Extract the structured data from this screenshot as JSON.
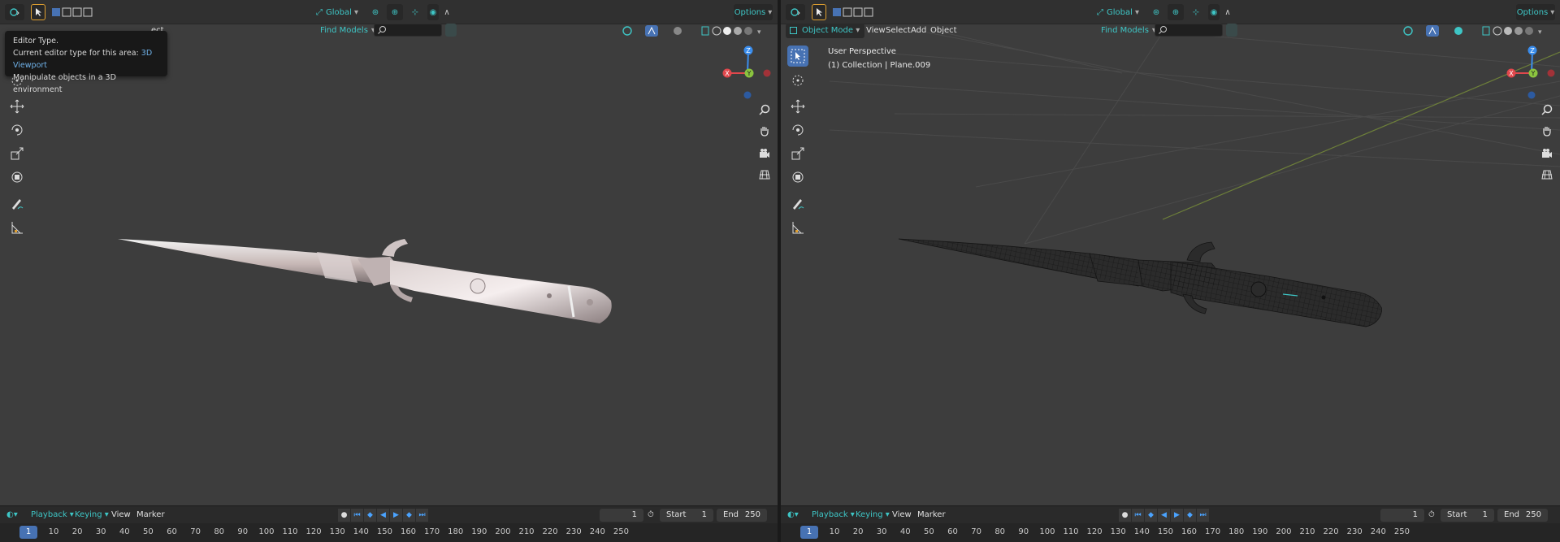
{
  "colors": {
    "accent_teal": "#3ec6c6",
    "active_blue": "#4772b3",
    "viewport_bg": "#3d3d3d",
    "axis_x": "#e0474c",
    "axis_y": "#8bc43f",
    "axis_z": "#3a8ded"
  },
  "left_viewport": {
    "header": {
      "transform_orientation": "Global",
      "options_label": "Options",
      "find_models_label": "Find Models",
      "select_fragment": "ect"
    },
    "tooltip": {
      "title": "Editor Type.",
      "line1_prefix": "Current editor type for this area:",
      "line1_value": "3D Viewport",
      "line2": "Manipulate objects in a 3D environment"
    },
    "timeline": {
      "playback": "Playback",
      "keying": "Keying",
      "view": "View",
      "marker": "Marker",
      "current_frame": "1",
      "start_label": "Start",
      "start_value": "1",
      "end_label": "End",
      "end_value": "250"
    },
    "ruler": {
      "current_frame": "1",
      "ticks": [
        "10",
        "20",
        "30",
        "40",
        "50",
        "60",
        "70",
        "80",
        "90",
        "100",
        "110",
        "120",
        "130",
        "140",
        "150",
        "160",
        "170",
        "180",
        "190",
        "200",
        "210",
        "220",
        "230",
        "240",
        "250"
      ]
    }
  },
  "right_viewport": {
    "header": {
      "transform_orientation": "Global",
      "options_label": "Options",
      "mode_label": "Object Mode",
      "menu_view": "View",
      "menu_select": "Select",
      "menu_add": "Add",
      "menu_object": "Object",
      "find_models_label": "Find Models"
    },
    "view_info": {
      "perspective": "User Perspective",
      "collection": "(1) Collection | Plane.009"
    },
    "timeline": {
      "playback": "Playback",
      "keying": "Keying",
      "view": "View",
      "marker": "Marker",
      "current_frame": "1",
      "start_label": "Start",
      "start_value": "1",
      "end_label": "End",
      "end_value": "250"
    },
    "ruler": {
      "current_frame": "1",
      "ticks": [
        "10",
        "20",
        "30",
        "40",
        "50",
        "60",
        "70",
        "80",
        "90",
        "100",
        "110",
        "120",
        "130",
        "140",
        "150",
        "160",
        "170",
        "180",
        "190",
        "200",
        "210",
        "220",
        "230",
        "240",
        "250"
      ]
    }
  },
  "icons": {
    "editor_type": "editor-type-icon",
    "select_tool": "cursor-icon",
    "move": "move-icon",
    "rotate": "rotate-icon",
    "scale": "scale-icon",
    "transform": "transform-icon",
    "annotate": "annotate-icon",
    "measure": "measure-icon",
    "zoom": "zoom-icon",
    "pan": "hand-icon",
    "camera": "camera-icon",
    "ortho": "grid-icon"
  },
  "gizmo_axes": {
    "x": "X",
    "y": "Y",
    "z": "Z"
  }
}
